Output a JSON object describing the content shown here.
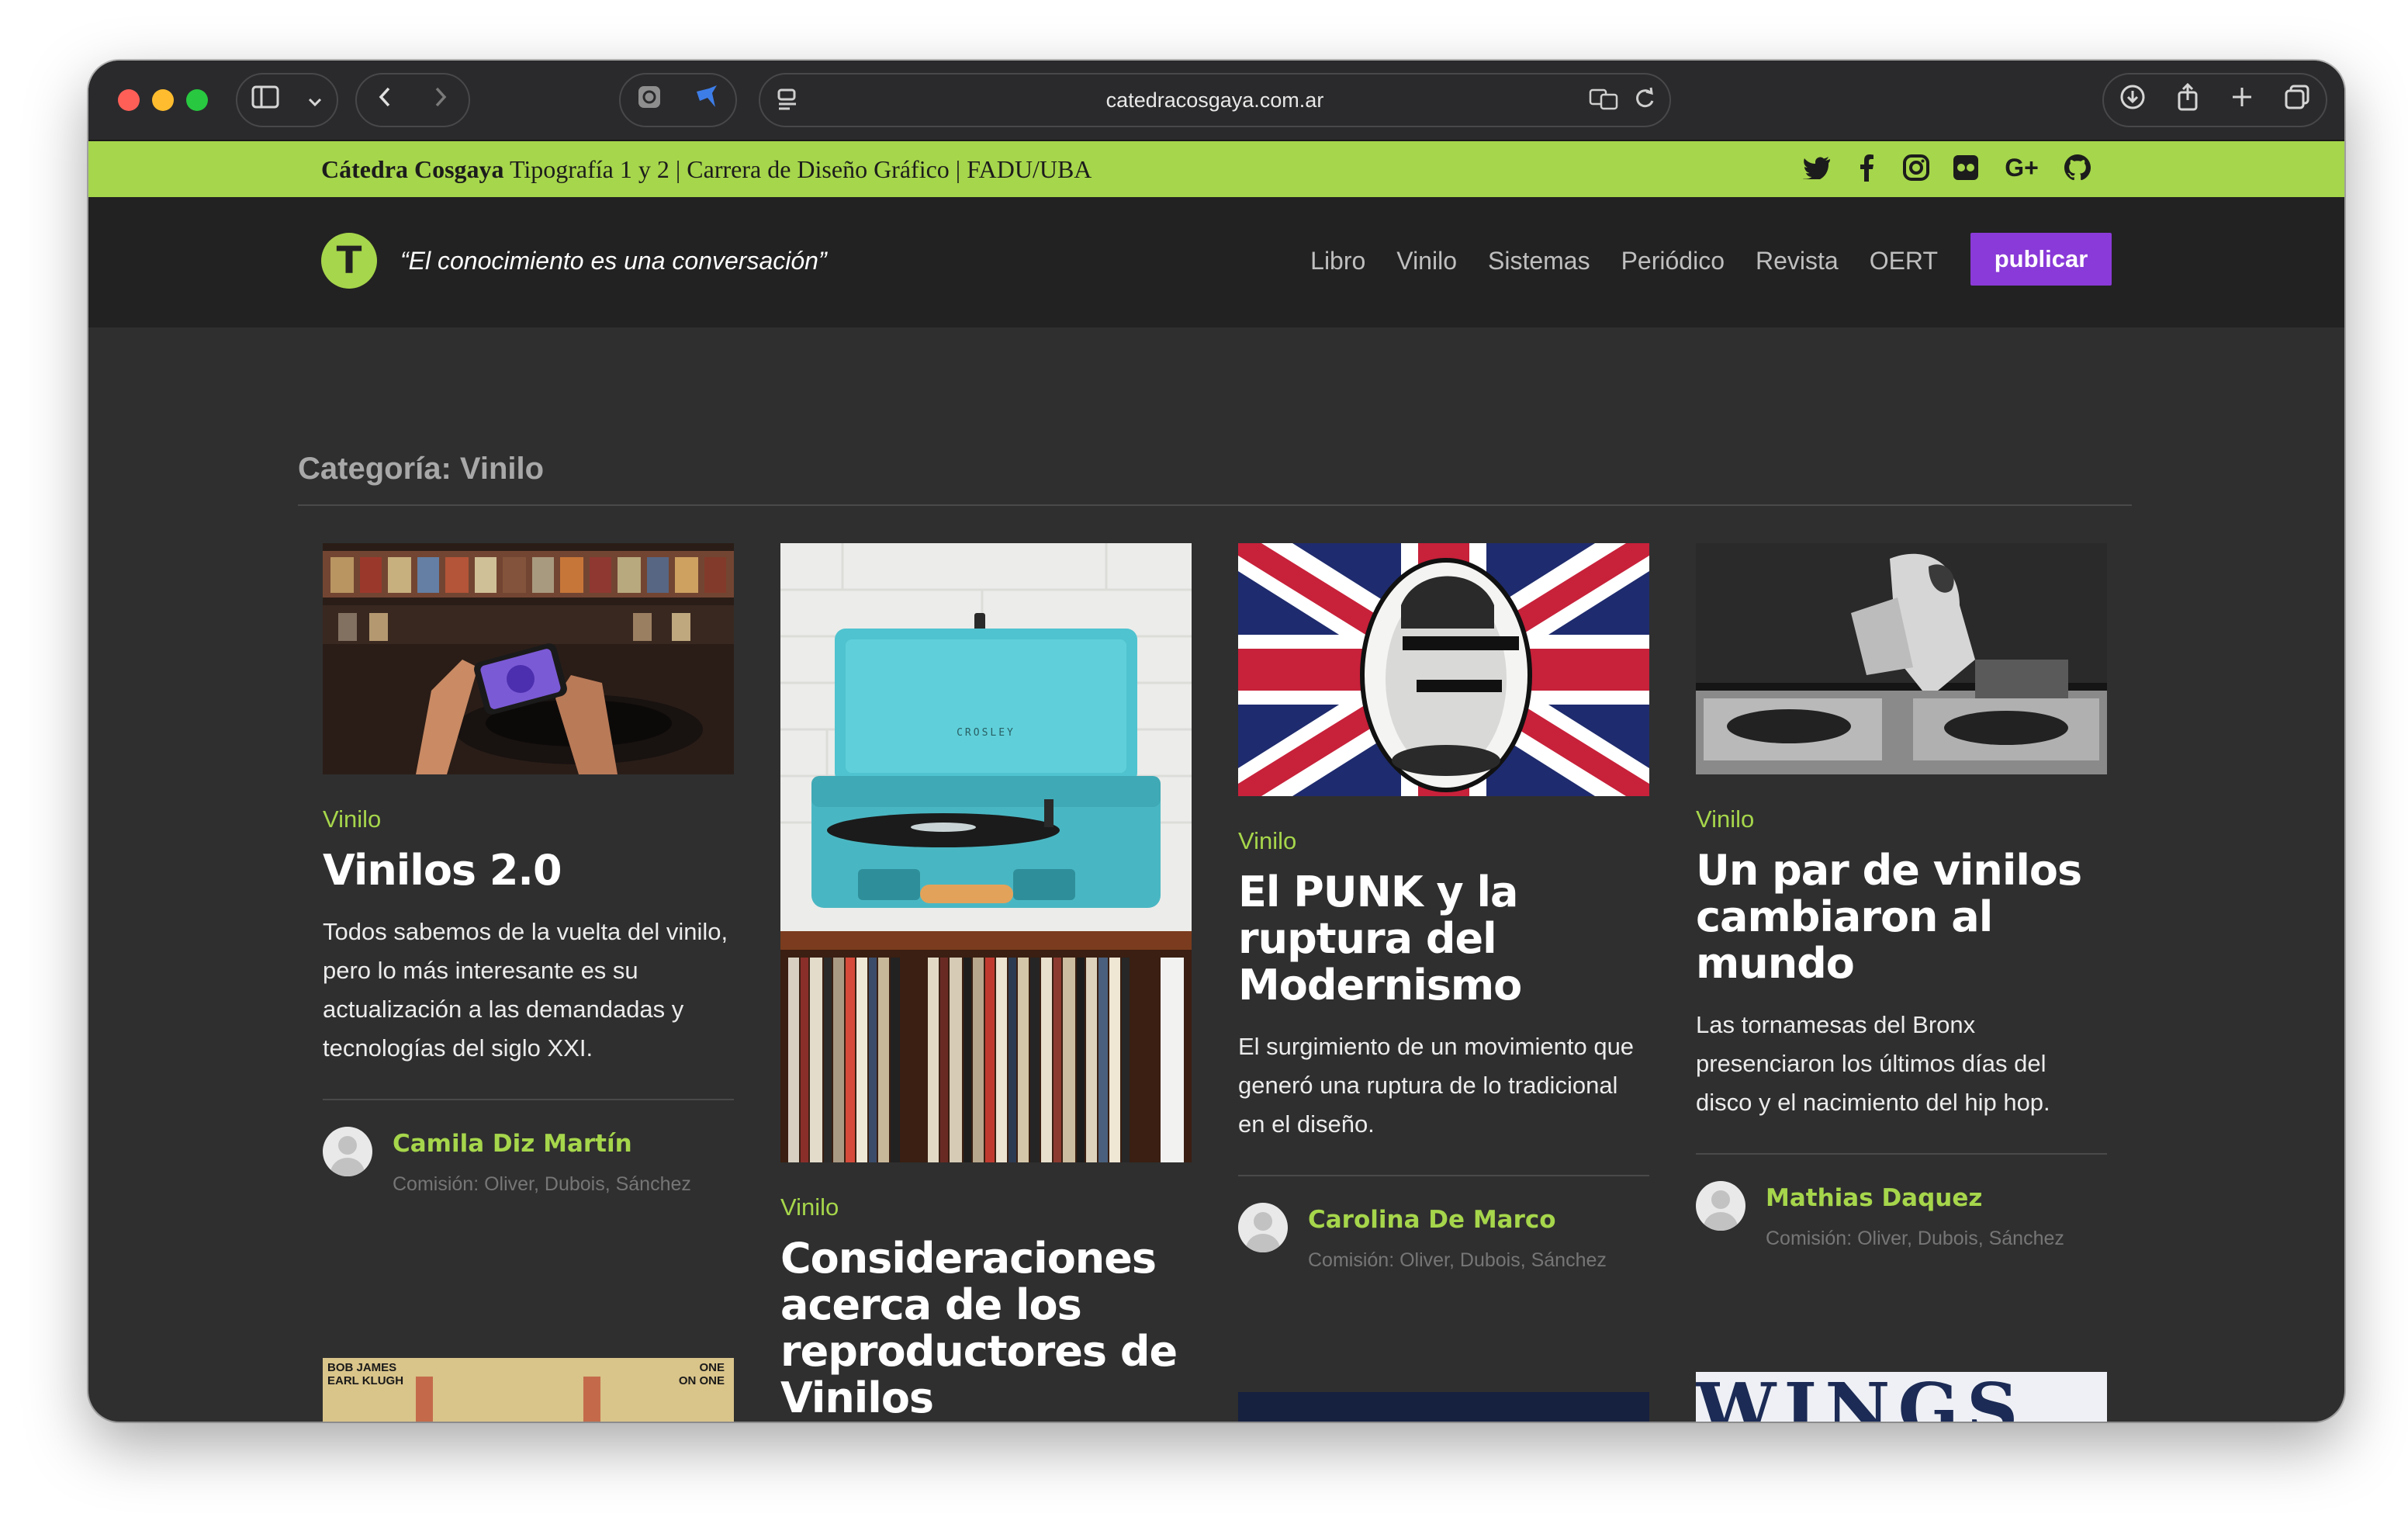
{
  "browser": {
    "url": "catedracosgaya.com.ar"
  },
  "topstrip": {
    "brand": "Cátedra Cosgaya",
    "rest": " Tipografía 1 y 2 | Carrera de Diseño Gráfico | FADU/UBA",
    "social_icons": [
      "twitter-icon",
      "facebook-icon",
      "instagram-icon",
      "flickr-icon",
      "google-plus-icon",
      "github-icon"
    ],
    "gplus_label": "G+"
  },
  "header": {
    "logo_letter": "T",
    "tagline": "“El conocimiento es una conversación”",
    "nav": [
      "Libro",
      "Vinilo",
      "Sistemas",
      "Periódico",
      "Revista",
      "OERT"
    ],
    "publish_label": "publicar"
  },
  "page": {
    "category_title": "Categoría: Vinilo"
  },
  "cards": [
    {
      "category": "Vinilo",
      "title": "Vinilos 2.0",
      "excerpt": "Todos sabemos de la vuelta del vinilo, pero lo más interesante es su actualización a las demandadas y tecnologías del siglo XXI.",
      "author": "Camila Diz Martín",
      "commission": "Comisión: Oliver, Dubois, Sánchez"
    },
    {
      "category": "Vinilo",
      "title": "Consideraciones acerca de los reproductores de Vinilos",
      "brand_text": "CROSLEY"
    },
    {
      "category": "Vinilo",
      "title": "El PUNK y la ruptura del Modernismo",
      "excerpt": "El surgimiento de un movimiento que generó una ruptura de lo tradicional en el diseño.",
      "author": "Carolina De Marco",
      "commission": "Comisión: Oliver, Dubois, Sánchez"
    },
    {
      "category": "Vinilo",
      "title": "Un par de vinilos cambiaron al mundo",
      "excerpt": "Las tornamesas del Bronx presenciaron los últimos días del disco y el nacimiento del hip hop.",
      "author": "Mathias Daquez",
      "commission": "Comisión: Oliver, Dubois, Sánchez"
    }
  ],
  "next_row": {
    "album1_left": "BOB JAMES\nEARL KLUGH",
    "album1_right": "ONE\nON ONE",
    "album4_word": "WINGS"
  },
  "colors": {
    "accent_green": "#a6d64b",
    "publish_purple": "#8a3ad8",
    "header_bg": "#222222",
    "content_bg": "#2f2f2f"
  }
}
